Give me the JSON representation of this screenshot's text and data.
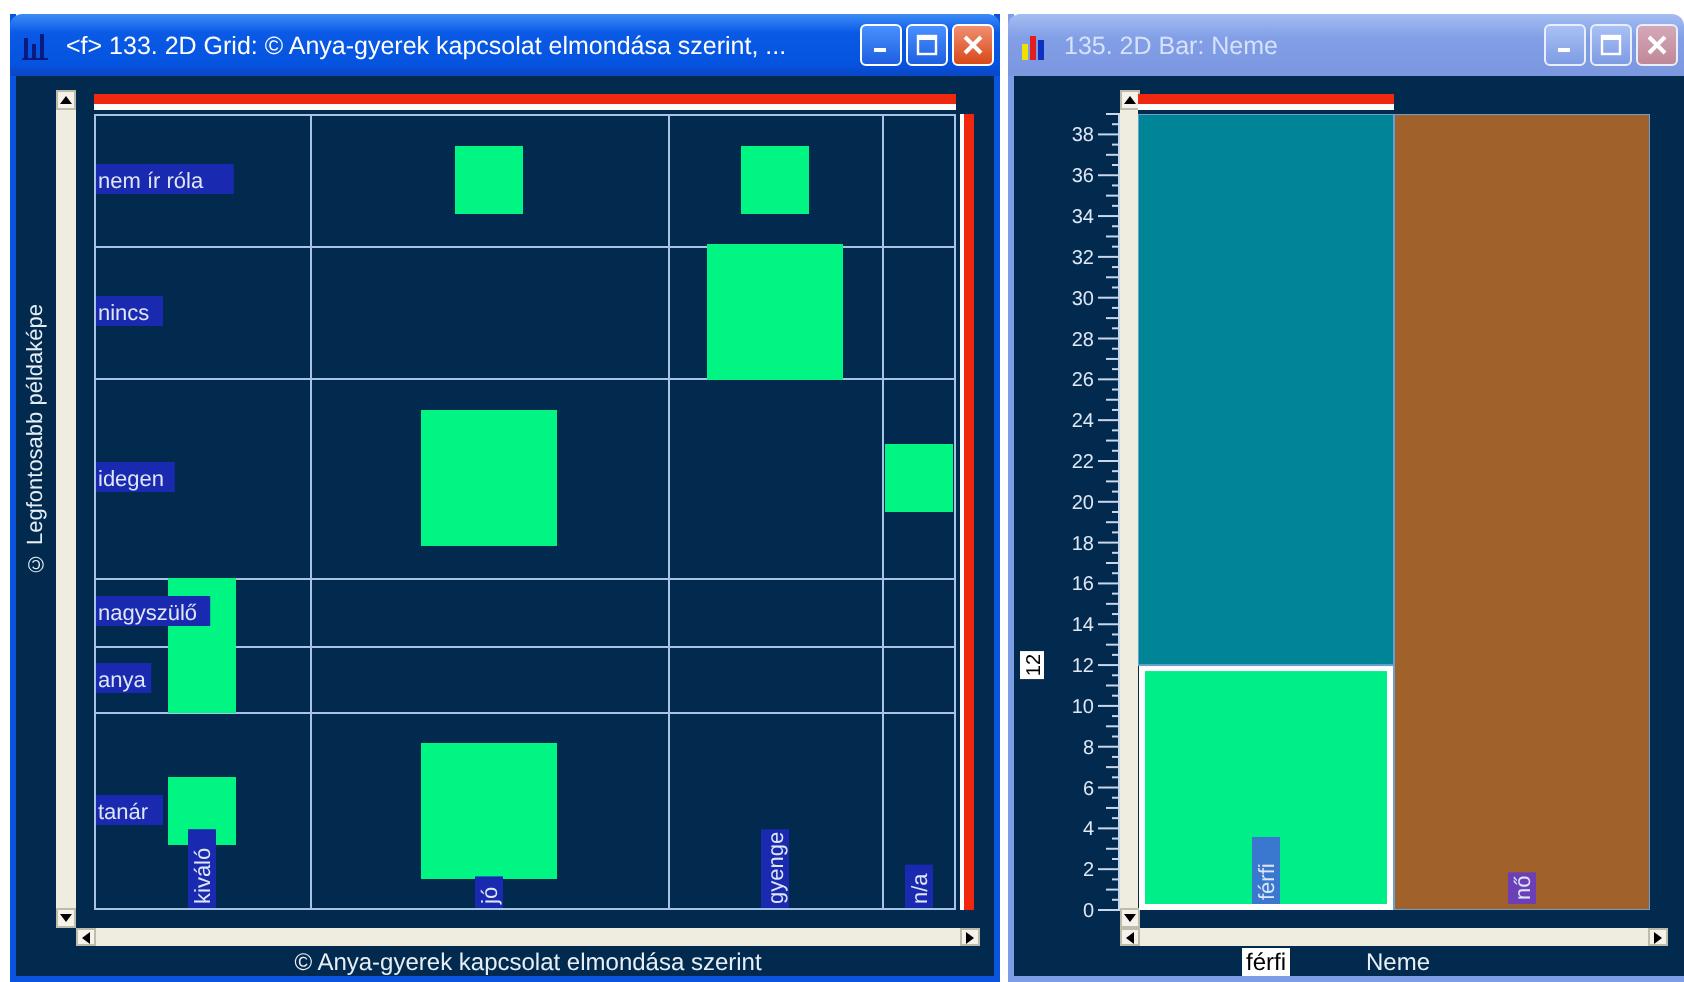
{
  "windows": [
    {
      "kind": "grid",
      "title": "<f> 133. 2D Grid: © Anya-gyerek kapcsolat elmondása szerint, ...",
      "active": true,
      "y_axis_title": "© Legfontosabb példaképe",
      "x_axis_title": "© Anya-gyerek kapcsolat elmondása szerint",
      "columns": [
        "kiváló",
        "jó",
        "gyenge",
        "n/a"
      ],
      "rows": [
        {
          "label": "nem ír róla",
          "cells": [
            {
              "kind": "empty"
            },
            {
              "kind": "small"
            },
            {
              "kind": "small"
            },
            {
              "kind": "empty"
            }
          ]
        },
        {
          "label": "nincs",
          "cells": [
            {
              "kind": "empty"
            },
            {
              "kind": "empty"
            },
            {
              "kind": "large"
            },
            {
              "kind": "empty"
            }
          ]
        },
        {
          "label": "idegen",
          "cells": [
            {
              "kind": "empty"
            },
            {
              "kind": "large"
            },
            {
              "kind": "empty"
            },
            {
              "kind": "small"
            }
          ]
        },
        {
          "label": "nagyszülő",
          "cells": [
            {
              "kind": "small"
            },
            {
              "kind": "empty"
            },
            {
              "kind": "empty"
            },
            {
              "kind": "empty"
            }
          ]
        },
        {
          "label": "anya",
          "cells": [
            {
              "kind": "small"
            },
            {
              "kind": "empty"
            },
            {
              "kind": "empty"
            },
            {
              "kind": "empty"
            }
          ]
        },
        {
          "label": "tanár",
          "cells": [
            {
              "kind": "small"
            },
            {
              "kind": "large"
            },
            {
              "kind": "empty"
            },
            {
              "kind": "empty"
            }
          ]
        }
      ]
    },
    {
      "kind": "bar",
      "title": "135. 2D Bar: Neme",
      "active": false,
      "y_marker": "12",
      "x_marker": "férfi",
      "x_axis_title": "Neme",
      "chart_data": {
        "type": "bar",
        "categories": [
          "férfi",
          "nő"
        ],
        "stacked": true,
        "ylim": [
          0,
          39
        ],
        "yticks": [
          0,
          2,
          4,
          6,
          8,
          10,
          12,
          14,
          16,
          18,
          20,
          22,
          24,
          26,
          28,
          30,
          32,
          34,
          36,
          38
        ],
        "series": [
          {
            "color": "#00ee88",
            "values": [
              12,
              null
            ]
          },
          {
            "color": "#008597",
            "values": [
              27,
              null
            ]
          },
          {
            "color": "#a0622a",
            "values": [
              null,
              39
            ]
          }
        ]
      }
    }
  ]
}
